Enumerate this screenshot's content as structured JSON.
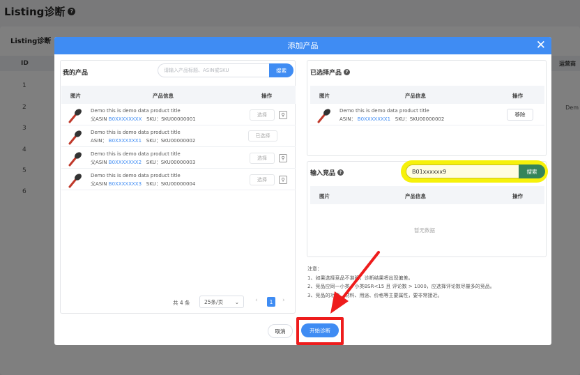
{
  "page": {
    "title": "Listing诊断",
    "section": "Listing诊断",
    "col_id": "ID",
    "col_ops": "运营商",
    "row_ids": [
      "1",
      "2",
      "3",
      "4",
      "5",
      "6"
    ],
    "side_text": "Dem"
  },
  "modal": {
    "title": "添加产品",
    "my_products": {
      "title": "我的产品",
      "search_placeholder": "请输入产品标题、ASIN或SKU",
      "search_label": "搜索",
      "columns": {
        "image": "图片",
        "info": "产品信息",
        "ops": "操作"
      },
      "rows": [
        {
          "title": "Demo this is demo data product title",
          "prefix": "父ASIN",
          "asin": "B0XXXXXXXX",
          "sku": "SKU：SKU00000001",
          "action": "选择",
          "selected": false
        },
        {
          "title": "Demo this is demo data product title",
          "prefix": "ASIN：",
          "asin": "B0XXXXXXX1",
          "sku": "SKU：SKU00000002",
          "action": "已选择",
          "selected": true
        },
        {
          "title": "Demo this is demo data product title",
          "prefix": "父ASIN",
          "asin": "B0XXXXXXX2",
          "sku": "SKU：SKU00000003",
          "action": "选择",
          "selected": false
        },
        {
          "title": "Demo this is demo data product title",
          "prefix": "父ASIN",
          "asin": "B0XXXXXXX3",
          "sku": "SKU：SKU00000004",
          "action": "选择",
          "selected": false
        }
      ],
      "pager": {
        "total": "共 4 条",
        "page_size": "25条/页",
        "current_page": "1"
      }
    },
    "selected_products": {
      "title": "已选择产品",
      "columns": {
        "image": "图片",
        "info": "产品信息",
        "ops": "操作"
      },
      "rows": [
        {
          "title": "Demo this is demo data product title",
          "prefix": "ASIN：",
          "asin": "B0XXXXXXX1",
          "sku": "SKU：SKU00000002",
          "action": "移除"
        }
      ]
    },
    "competitor": {
      "title": "输入竞品",
      "input_value": "B01xxxxxx9",
      "search_label": "搜索",
      "columns": {
        "image": "图片",
        "info": "产品信息",
        "ops": "操作"
      },
      "empty": "暂无数据"
    },
    "notes": {
      "heading": "注意：",
      "lines": [
        "1、如果选择竞品不准确，诊断结果将出现偏差。",
        "2、竞品应同一小类，小类BSR<15 且 评论数 > 1000，应选择评论数尽量多的竞品。",
        "3、竞品的功能、材料、用途、价格等主要属性，要非常接近。"
      ]
    },
    "footer": {
      "cancel": "取消",
      "start": "开始诊断"
    }
  },
  "colors": {
    "primary": "#3f8cf3",
    "highlight": "#f6f10a",
    "annotation_red": "#ee1c1c",
    "comp_button": "#35845a"
  }
}
